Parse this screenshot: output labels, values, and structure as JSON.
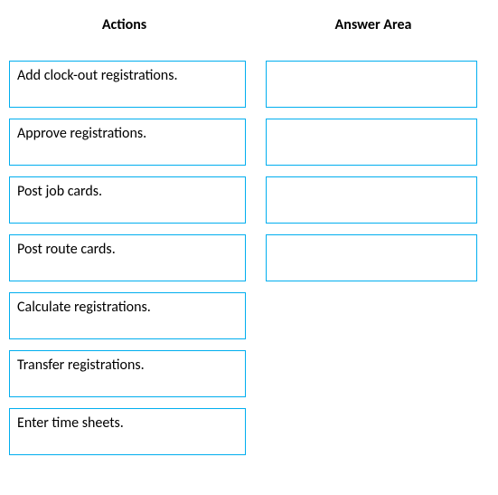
{
  "headers": {
    "actions": "Actions",
    "answer": "Answer Area"
  },
  "actions": [
    {
      "label": "Add clock-out registrations."
    },
    {
      "label": "Approve registrations."
    },
    {
      "label": "Post job cards."
    },
    {
      "label": "Post route cards."
    },
    {
      "label": "Calculate registrations."
    },
    {
      "label": "Transfer registrations."
    },
    {
      "label": "Enter time sheets."
    }
  ],
  "answer_slots": 4
}
